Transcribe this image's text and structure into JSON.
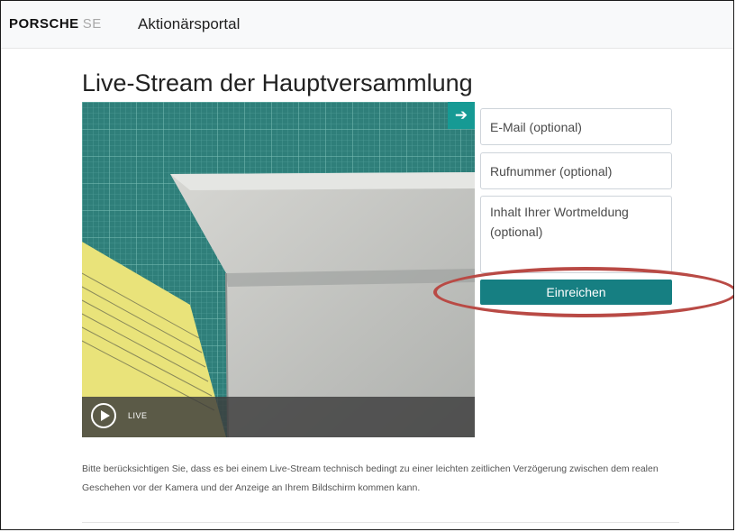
{
  "navbar": {
    "brand_main": "PORSCHE",
    "brand_sub": "SE",
    "portal_title": "Aktionärsportal"
  },
  "main": {
    "title": "Live-Stream der Hauptversammlung",
    "notice": "Bitte berücksichtigen Sie, dass es bei einem Live-Stream technisch bedingt zu einer leichten zeitlichen Verzögerung zwischen dem realen Geschehen vor der Kamera und der Anzeige an Ihrem Bildschirm kommen kann."
  },
  "player": {
    "live_label": "LIVE",
    "expand_icon": "arrow-right-icon",
    "play_icon": "play-circle-icon"
  },
  "form": {
    "email_placeholder": "E-Mail (optional)",
    "phone_placeholder": "Rufnummer (optional)",
    "message_placeholder": "Inhalt Ihrer Wortmeldung (optional)",
    "submit_label": "Einreichen"
  },
  "colors": {
    "accent": "#167f82",
    "highlight": "#b94a45"
  }
}
